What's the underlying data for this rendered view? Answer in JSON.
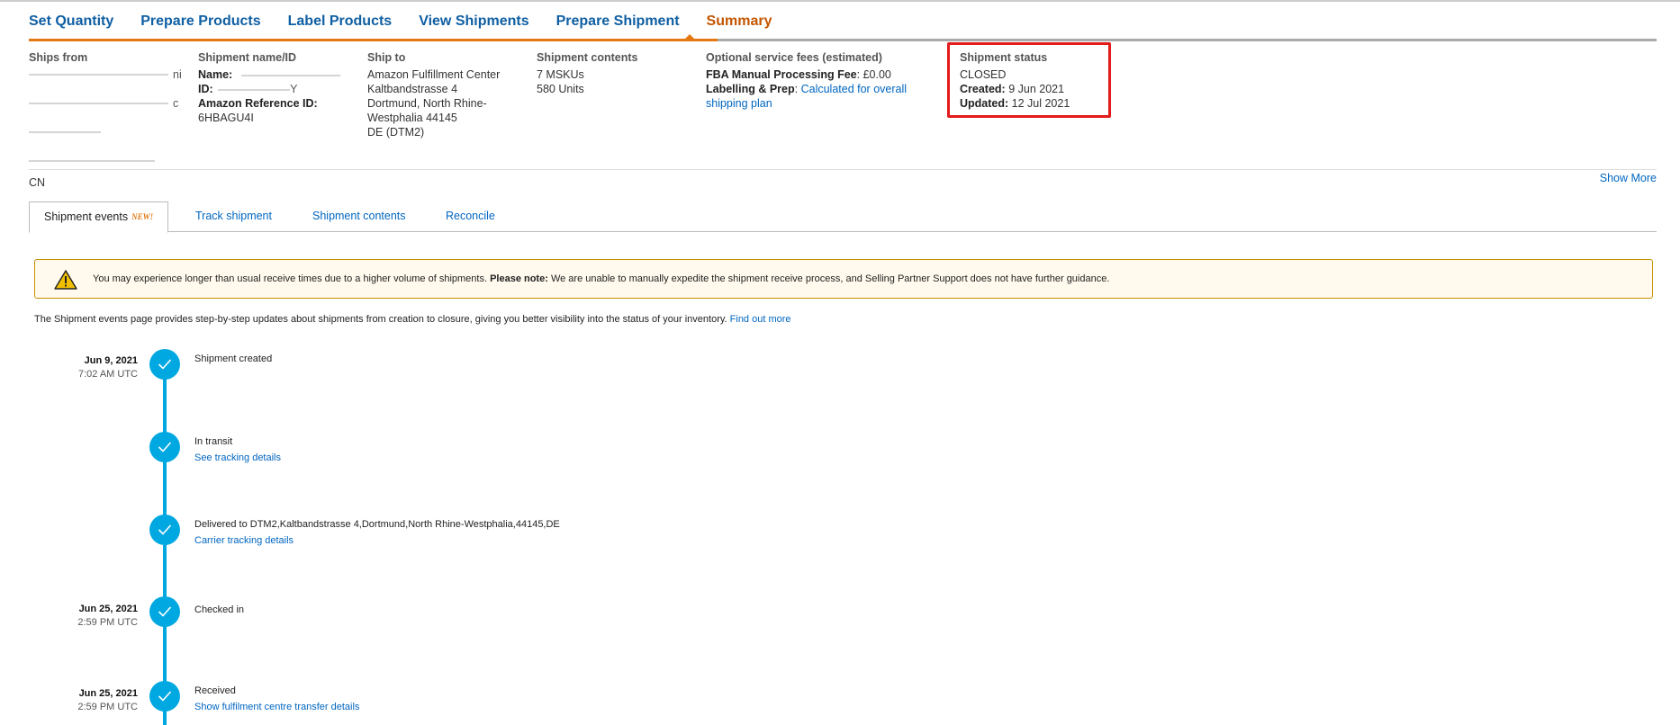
{
  "workflow": {
    "steps": [
      "Set Quantity",
      "Prepare Products",
      "Label Products",
      "View Shipments",
      "Prepare Shipment",
      "Summary"
    ],
    "active": "Summary"
  },
  "summary": {
    "ships_from": {
      "header": "Ships from",
      "country": "CN"
    },
    "shipment_name": {
      "header": "Shipment name/ID",
      "name_label": "Name:",
      "id_label": "ID:",
      "ref_label": "Amazon Reference ID:",
      "ref_value": "6HBAGU4I"
    },
    "ship_to": {
      "header": "Ship to",
      "lines": [
        "Amazon Fulfillment Center",
        "Kaltbandstrasse 4",
        "Dortmund, North Rhine-",
        "Westphalia 44145",
        "DE (DTM2)"
      ]
    },
    "contents": {
      "header": "Shipment contents",
      "mskus": "7 MSKUs",
      "units": "580 Units"
    },
    "fees": {
      "header": "Optional service fees (estimated)",
      "fba_label": "FBA Manual Processing Fee",
      "fba_value": ": £0.00",
      "labelling_label": "Labelling & Prep",
      "labelling_sep": ": ",
      "labelling_link_1": "Calculated for overall",
      "labelling_link_2": "shipping plan"
    },
    "status": {
      "header": "Shipment status",
      "value": "CLOSED",
      "created_label": "Created:",
      "created_value": " 9 Jun 2021",
      "updated_label": "Updated:",
      "updated_value": " 12 Jul 2021",
      "highlight_color": "#e21b1b"
    },
    "show_more": "Show More"
  },
  "tabs": {
    "items": [
      "Shipment events",
      "Track shipment",
      "Shipment contents",
      "Reconcile"
    ],
    "new_badge": "NEW!",
    "active": "Shipment events"
  },
  "alert": {
    "icon": "warning-icon",
    "text": "You may experience longer than usual receive times due to a higher volume of shipments. ",
    "bold": "Please note:",
    "text2": " We are unable to manually expedite the shipment receive process, and Selling Partner Support does not have further guidance."
  },
  "intro": {
    "text": "The Shipment events page provides step-by-step updates about shipments from creation to closure, giving you better visibility into the status of your inventory. ",
    "link": "Find out more"
  },
  "timeline": {
    "accent": "#00a8e1",
    "events": [
      {
        "date": "Jun 9, 2021",
        "time": "7:02 AM UTC",
        "title": "Shipment created",
        "link": ""
      },
      {
        "date": "",
        "time": "",
        "title": "In transit",
        "link": "See tracking details"
      },
      {
        "date": "",
        "time": "",
        "title": "Delivered to DTM2,Kaltbandstrasse 4,Dortmund,North Rhine-Westphalia,44145,DE",
        "link": "Carrier tracking details"
      },
      {
        "date": "Jun 25, 2021",
        "time": "2:59 PM UTC",
        "title": "Checked in",
        "link": ""
      },
      {
        "date": "Jun 25, 2021",
        "time": "2:59 PM UTC",
        "title": "Received",
        "link": "Show fulfilment centre transfer details"
      }
    ]
  }
}
